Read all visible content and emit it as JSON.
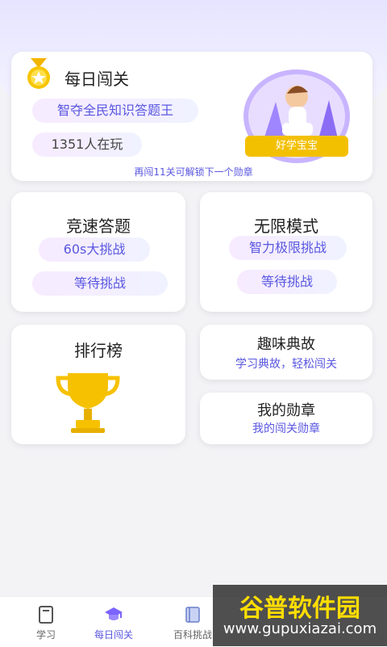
{
  "hero": {
    "title": "每日闯关",
    "subtitle": "智夺全民知识答题王",
    "players": "1351人在玩",
    "caption": "好学宝宝",
    "hint": "再闯11关可解锁下一个勋章"
  },
  "cards": {
    "speed": {
      "title": "竞速答题",
      "pill1": "60s大挑战",
      "pill2": "等待挑战"
    },
    "infinite": {
      "title": "无限模式",
      "pill1": "智力极限挑战",
      "pill2": "等待挑战"
    },
    "ranking": {
      "title": "排行榜"
    },
    "fun": {
      "title": "趣味典故",
      "subtitle": "学习典故，轻松闯关"
    },
    "medals": {
      "title": "我的勋章",
      "subtitle": "我的闯关勋章"
    }
  },
  "tabbar": {
    "items": [
      {
        "label": "学习",
        "icon": "notebook-icon"
      },
      {
        "label": "每日闯关",
        "icon": "graduation-cap-icon"
      },
      {
        "label": "百科挑战",
        "icon": "book-icon"
      }
    ],
    "active_index": 1
  },
  "watermark": {
    "title": "谷普软件园",
    "url": "www.gupuxiazai.com"
  },
  "colors": {
    "accent": "#5a57e0",
    "gold": "#f3c000"
  }
}
